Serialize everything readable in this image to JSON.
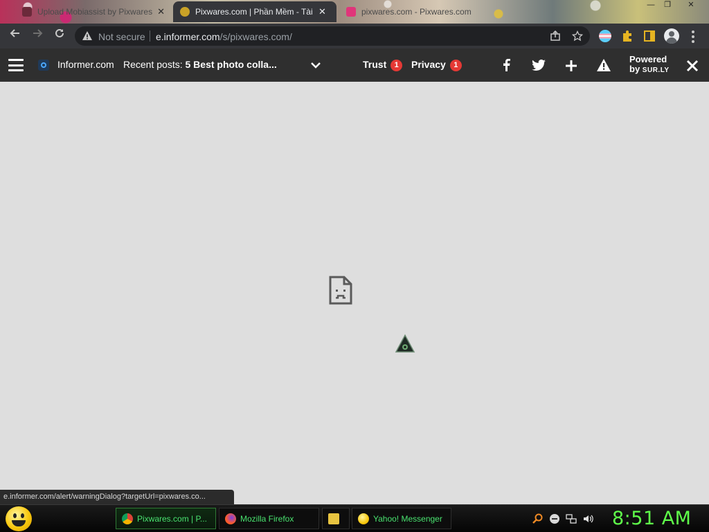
{
  "tabs": [
    {
      "title": "Upload Mobiassist by Pixwares",
      "close": "✕"
    },
    {
      "title": "Pixwares.com | Phần Mềm - Tài L",
      "close": "✕"
    },
    {
      "title": "pixwares.com - Pixwares.com"
    }
  ],
  "window": {
    "minimize": "—",
    "maximize": "❐",
    "close": "✕"
  },
  "toolbar": {
    "security_label": "Not secure",
    "url_domain": "e.informer.com",
    "url_path": "/s/pixwares.com/"
  },
  "informer": {
    "brand": "Informer.com",
    "recent_prefix": "Recent posts:",
    "recent_title": "5 Best photo colla...",
    "trust_label": "Trust",
    "trust_count": "1",
    "privacy_label": "Privacy",
    "privacy_count": "1",
    "powered_line1": "Powered",
    "powered_by": "by",
    "powered_brand": "SUR.LY"
  },
  "status_url": "e.informer.com/alert/warningDialog?targetUrl=pixwares.co...",
  "taskbar": {
    "items": [
      {
        "label": "Pixwares.com | P..."
      },
      {
        "label": "Mozilla Firefox"
      },
      {
        "label": ""
      },
      {
        "label": "Yahoo! Messenger"
      }
    ],
    "clock": "8:51 AM"
  },
  "colors": {
    "toolbar_bg": "#35363a",
    "informer_bg": "#2f2f2f",
    "badge_red": "#e53935",
    "taskbar_text": "#49e26f",
    "clock": "#5fff4a",
    "page_bg": "#dedede"
  }
}
